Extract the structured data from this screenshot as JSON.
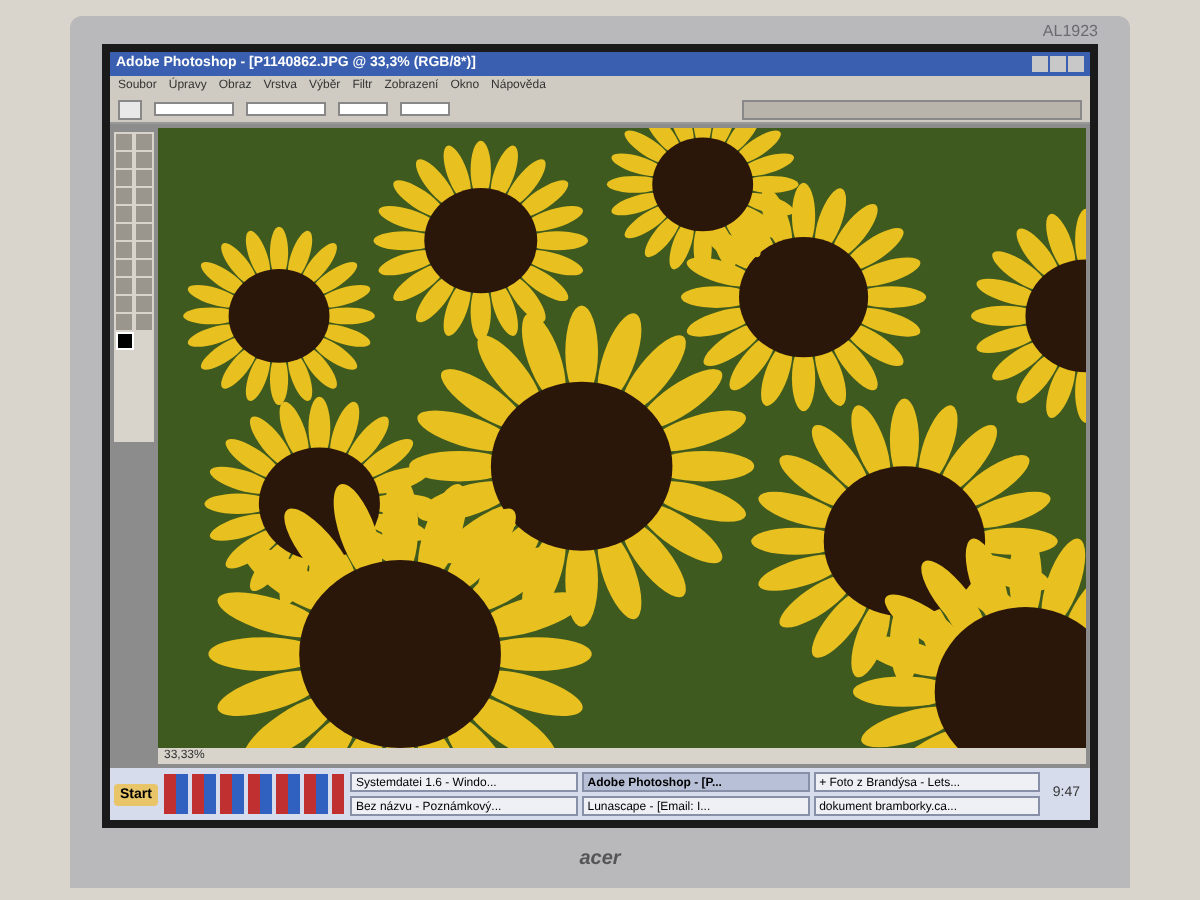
{
  "monitor": {
    "model": "AL1923",
    "brand": "acer"
  },
  "window": {
    "title": "Adobe Photoshop - [P1140862.JPG @ 33,3% (RGB/8*)]"
  },
  "menu": [
    "Soubor",
    "Úpravy",
    "Obraz",
    "Vrstva",
    "Výběr",
    "Filtr",
    "Zobrazení",
    "Okno",
    "Nápověda"
  ],
  "status_bar": {
    "zoom": "33,33%"
  },
  "taskbar": {
    "start": "Start",
    "tasks": [
      {
        "label": "Systemdatei 1.6 - Windo...",
        "selected": false
      },
      {
        "label": "Adobe Photoshop - [P...",
        "selected": true
      },
      {
        "label": "+ Foto z Brandýsa - Lets...",
        "selected": false
      },
      {
        "label": "Bez názvu - Poznámkový...",
        "selected": false
      },
      {
        "label": "Lunascape - [Email: I...",
        "selected": false
      },
      {
        "label": "dokument bramborky.ca...",
        "selected": false
      }
    ],
    "clock": "9:47"
  }
}
